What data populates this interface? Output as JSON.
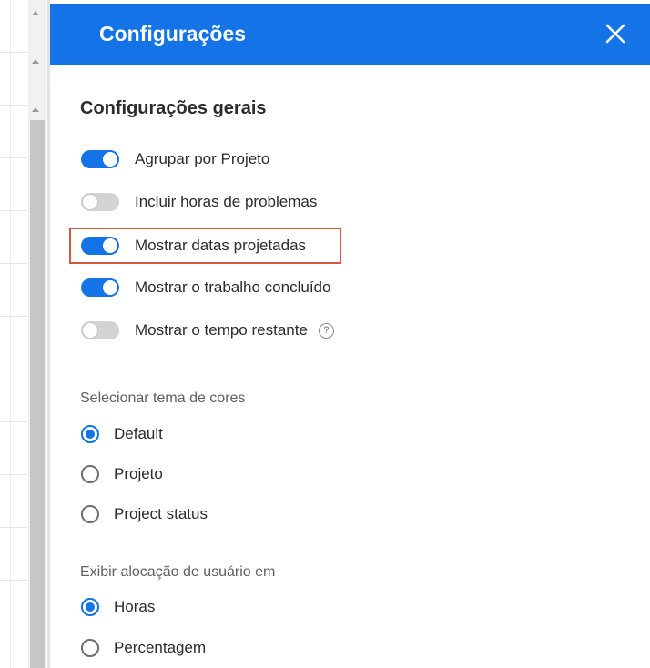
{
  "panel": {
    "title": "Configurações",
    "close_icon": "close-icon",
    "accent_color": "#1473e6"
  },
  "general": {
    "title": "Configurações gerais",
    "toggles": [
      {
        "label": "Agrupar por Projeto",
        "on": true
      },
      {
        "label": "Incluir horas de problemas",
        "on": false
      },
      {
        "label": "Mostrar datas projetadas",
        "on": true,
        "highlighted": true
      },
      {
        "label": "Mostrar o trabalho concluído",
        "on": true
      },
      {
        "label": "Mostrar o tempo restante",
        "on": false,
        "help_icon": "question-circle-icon",
        "help_glyph": "?"
      }
    ],
    "highlight_color": "#d15a3c"
  },
  "color_theme": {
    "label": "Selecionar tema de cores",
    "options": [
      {
        "label": "Default",
        "selected": true
      },
      {
        "label": "Projeto",
        "selected": false
      },
      {
        "label": "Project status",
        "selected": false
      }
    ]
  },
  "allocation": {
    "label": "Exibir alocação de usuário em",
    "options": [
      {
        "label": "Horas",
        "selected": true
      },
      {
        "label": "Percentagem",
        "selected": false
      }
    ]
  }
}
